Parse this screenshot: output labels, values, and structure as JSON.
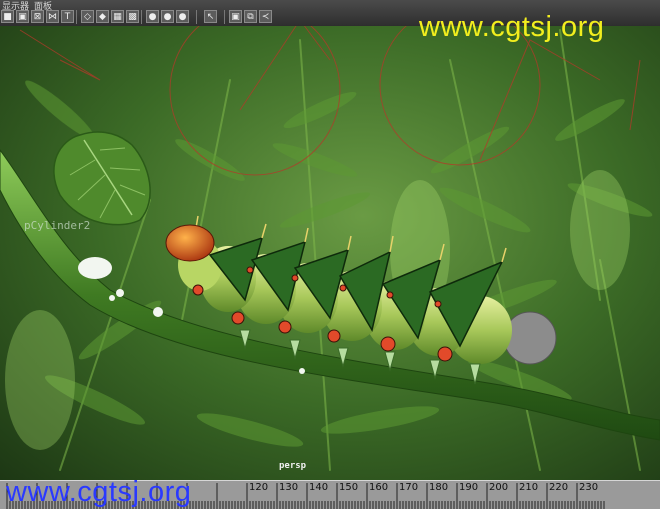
{
  "window": {
    "menu_items": [
      "显示器",
      "面板"
    ]
  },
  "toolbar": {
    "icons": [
      {
        "name": "select-mode-icon",
        "glyph": "■"
      },
      {
        "name": "render-region-icon",
        "glyph": "▣"
      },
      {
        "name": "wireframe-icon",
        "glyph": "⊠"
      },
      {
        "name": "uv-icon",
        "glyph": "⋈"
      },
      {
        "name": "text-tool-icon",
        "glyph": "T"
      },
      {
        "name": "wire-cube-icon",
        "glyph": "◇"
      },
      {
        "name": "smooth-cube-icon",
        "glyph": "◆"
      },
      {
        "name": "textured-cube-icon",
        "glyph": "▦"
      },
      {
        "name": "checker-icon",
        "glyph": "▩"
      },
      {
        "name": "light-icon",
        "glyph": "●"
      },
      {
        "name": "shadow-icon",
        "glyph": "●"
      },
      {
        "name": "shaded-sphere-icon",
        "glyph": "●"
      },
      {
        "name": "cursor-icon",
        "glyph": "↖"
      },
      {
        "name": "camera-icon",
        "glyph": "▣"
      },
      {
        "name": "resolution-gate-icon",
        "glyph": "⧉"
      },
      {
        "name": "share-icon",
        "glyph": "≺"
      }
    ]
  },
  "viewport": {
    "camera_label": "persp",
    "object_label": "pCylinder2",
    "colors": {
      "sky": "#2c4f1f",
      "leaf": "#5c9630",
      "stem": "#3f7a22",
      "caterpillar_body": "#a8c85a",
      "caterpillar_spine": "#2b6a23",
      "head": "#d25a1a",
      "joint_lines": "#b23a2a",
      "watermark_top": "#f2ee1e",
      "watermark_bottom": "#2a39ff"
    }
  },
  "watermarks": {
    "top": "www.cgtsj.org",
    "bottom": "www.cgtsj.org"
  },
  "timeline": {
    "tick_labels": [
      "120",
      "130",
      "140",
      "150",
      "160",
      "170",
      "180",
      "190",
      "200",
      "210",
      "220",
      "230"
    ]
  }
}
